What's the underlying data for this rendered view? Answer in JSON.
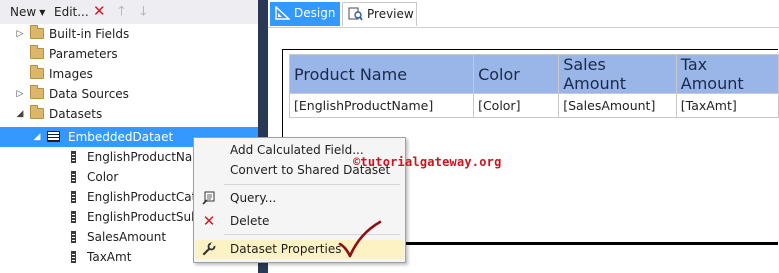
{
  "toolbar": {
    "new_label": "New",
    "edit_label": "Edit...",
    "delete_icon": "delete-icon",
    "move_up_icon": "arrow-up-icon",
    "move_down_icon": "arrow-down-icon"
  },
  "tree": {
    "items": [
      {
        "label": "Built-in Fields",
        "icon": "folder-icon",
        "expander": "collapsed"
      },
      {
        "label": "Parameters",
        "icon": "folder-icon",
        "expander": "none"
      },
      {
        "label": "Images",
        "icon": "folder-icon",
        "expander": "none"
      },
      {
        "label": "Data Sources",
        "icon": "folder-icon",
        "expander": "collapsed"
      },
      {
        "label": "Datasets",
        "icon": "folder-icon",
        "expander": "expanded"
      },
      {
        "label": "EmbeddedDataet",
        "icon": "table-icon",
        "expander": "expanded",
        "selected": true
      }
    ],
    "fields": [
      {
        "label": "EnglishProductNam",
        "icon": "field-icon"
      },
      {
        "label": "Color",
        "icon": "field-icon"
      },
      {
        "label": "EnglishProductCateg",
        "icon": "field-icon"
      },
      {
        "label": "EnglishProductSubc",
        "icon": "field-icon"
      },
      {
        "label": "SalesAmount",
        "icon": "field-icon"
      },
      {
        "label": "TaxAmt",
        "icon": "field-icon"
      }
    ]
  },
  "tabs": {
    "design": "Design",
    "preview": "Preview",
    "active": "Design"
  },
  "report": {
    "headers": [
      "Product Name",
      "Color",
      "Sales Amount",
      "Tax Amount"
    ],
    "row": [
      "[EnglishProductName]",
      "[Color]",
      "[SalesAmount]",
      "[TaxAmt]"
    ]
  },
  "context_menu": {
    "items": [
      {
        "label": "Add Calculated Field...",
        "icon": ""
      },
      {
        "label": "Convert to Shared Dataset",
        "icon": ""
      },
      {
        "label": "Query...",
        "icon": "query-icon"
      },
      {
        "label": "Delete",
        "icon": "delete-icon"
      },
      {
        "label": "Dataset Properties",
        "icon": "wrench-icon",
        "highlighted": true
      }
    ]
  },
  "watermark": "©tutorialgateway.org",
  "colors": {
    "selection": "#3399ff",
    "splitter": "#293955",
    "header_fill": "#9ab6e8",
    "menu_highlight": "#fdf2c4",
    "watermark": "#c8141e",
    "checkmark": "#8b0f14"
  }
}
